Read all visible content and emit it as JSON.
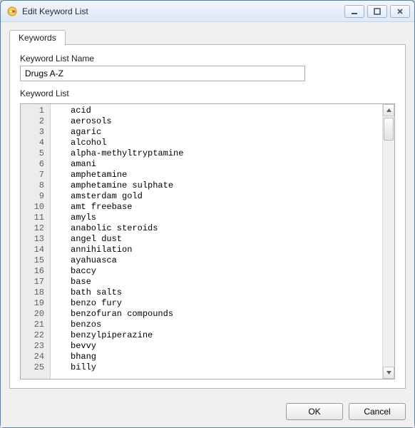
{
  "window": {
    "title": "Edit Keyword List",
    "minimize_tip": "Minimize",
    "maximize_tip": "Maximize",
    "close_tip": "Close"
  },
  "tabs": {
    "keywords": "Keywords"
  },
  "form": {
    "name_label": "Keyword List Name",
    "name_value": "Drugs A-Z",
    "list_label": "Keyword List"
  },
  "keywords": [
    "acid",
    "aerosols",
    "agaric",
    "alcohol",
    "alpha-methyltryptamine",
    "amani",
    "amphetamine",
    "amphetamine sulphate",
    "amsterdam gold",
    "amt freebase",
    "amyls",
    "anabolic steroids",
    "angel dust",
    "annihilation",
    "ayahuasca",
    "baccy",
    "base",
    "bath salts",
    "benzo fury",
    "benzofuran compounds",
    "benzos",
    "benzylpiperazine",
    "bevvy",
    "bhang",
    "billy"
  ],
  "buttons": {
    "ok": "OK",
    "cancel": "Cancel"
  }
}
